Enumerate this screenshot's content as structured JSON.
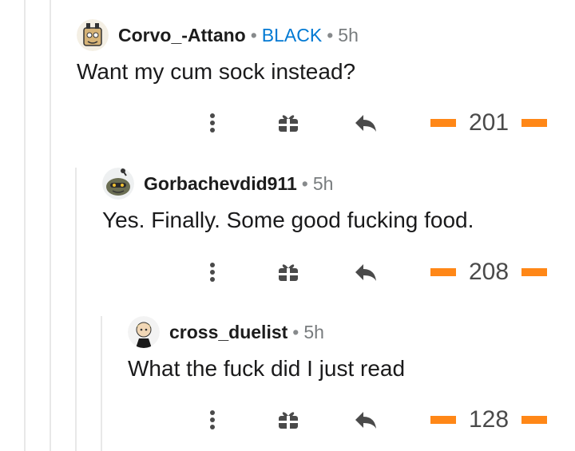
{
  "comments": [
    {
      "username": "Corvo_-Attano",
      "flair": "BLACK",
      "time": "5h",
      "text": "Want my cum sock instead?",
      "score": "201",
      "avatar_icon": "snoo-avatar-icon"
    },
    {
      "username": "Gorbachevdid911",
      "time": "5h",
      "text": "Yes. Finally. Some good fucking food.",
      "score": "208",
      "avatar_icon": "snoo-avatar-icon"
    },
    {
      "username": "cross_duelist",
      "time": "5h",
      "text": "What the fuck did I just read",
      "score": "128",
      "avatar_icon": "snoo-avatar-icon"
    }
  ],
  "action_icons": [
    "more-options-icon",
    "gift-icon",
    "reply-icon",
    "upvote-icon",
    "downvote-icon"
  ],
  "colors": {
    "vote": "#ff8717",
    "flair": "#0079d3",
    "thread_line": "#e8e8e8"
  }
}
